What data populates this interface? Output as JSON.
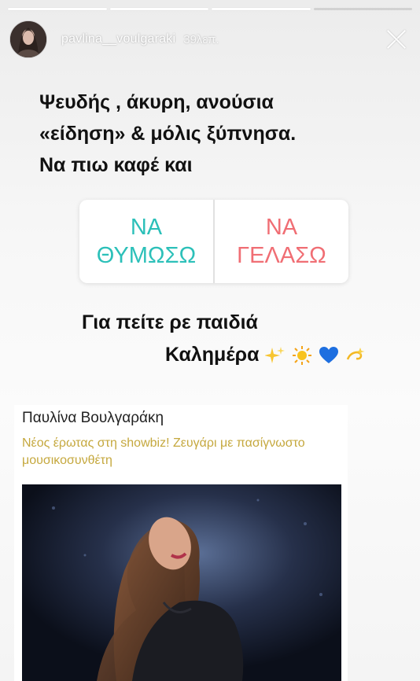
{
  "header": {
    "username": "pavlina__voulgaraki",
    "time": "39λεπ."
  },
  "progress": {
    "segments": 4,
    "completed": 3
  },
  "story": {
    "lines": [
      "Ψευδής , άκυρη, ανούσια",
      "«είδηση» & μόλις ξύπνησα.",
      "Να πιω καφέ και"
    ],
    "poll": {
      "option_a": [
        "ΝΑ",
        "ΘΥΜΩΣΩ"
      ],
      "option_b": [
        "ΝΑ",
        "ΓΕΛΑΣΩ"
      ],
      "colors": {
        "option_a": "#2cc0b9",
        "option_b": "#f06e74"
      }
    },
    "greeting_line1": "Για πείτε ρε παιδιά",
    "greeting_line2": "Καλημέρα",
    "emojis": [
      "sparkles-icon",
      "sun-icon",
      "blue-heart-icon",
      "dizzy-icon"
    ]
  },
  "card": {
    "name": "Παυλίνα Βουλγαράκη",
    "headline": "Νέος έρωτας στη showbiz! Ζευγάρι με πασίγνωστο μουσικοσυνθέτη",
    "headline_color": "#c5a83e"
  }
}
